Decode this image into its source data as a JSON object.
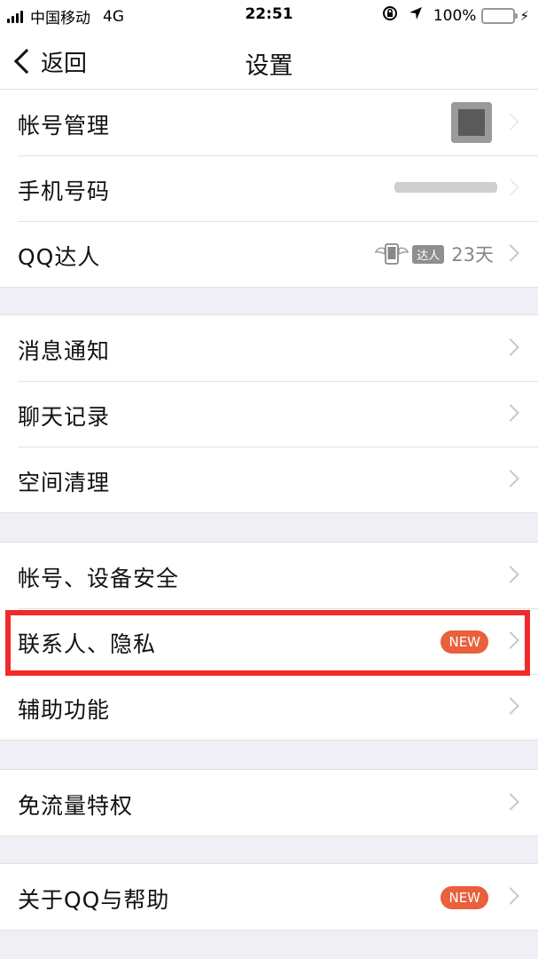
{
  "status_bar": {
    "carrier": "中国移动",
    "network": "4G",
    "time": "22:51",
    "battery": "100%",
    "battery_level": 1.0
  },
  "nav": {
    "back_label": "返回",
    "title": "设置"
  },
  "groups": [
    {
      "rows": [
        {
          "label": "帐号管理"
        },
        {
          "label": "手机号码"
        },
        {
          "label": "QQ达人",
          "tag": "达人",
          "days": "23天"
        }
      ]
    },
    {
      "rows": [
        {
          "label": "消息通知"
        },
        {
          "label": "聊天记录"
        },
        {
          "label": "空间清理"
        }
      ]
    },
    {
      "rows": [
        {
          "label": "帐号、设备安全"
        },
        {
          "label": "联系人、隐私",
          "badge": "NEW"
        },
        {
          "label": "辅助功能"
        }
      ]
    },
    {
      "rows": [
        {
          "label": "免流量特权"
        }
      ]
    },
    {
      "rows": [
        {
          "label": "关于QQ与帮助",
          "badge": "NEW"
        }
      ]
    }
  ],
  "colors": {
    "badge": "#e8603c",
    "highlight": "#f02a2a",
    "battery": "#4cd964",
    "background": "#f0eff5"
  }
}
